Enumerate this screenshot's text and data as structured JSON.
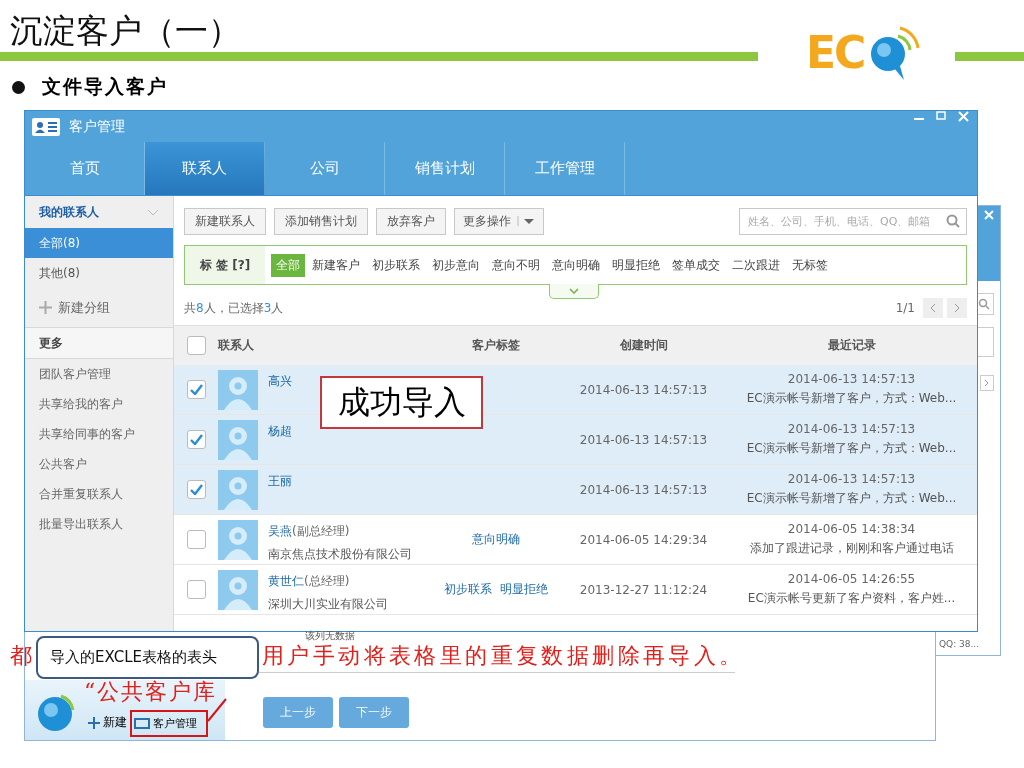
{
  "slide": {
    "title": "沉淀客户（一）",
    "bullet": "文件导入客户",
    "logo_text": "EC"
  },
  "window": {
    "title": "客户管理",
    "tabs": [
      {
        "label": "首页",
        "selected": false
      },
      {
        "label": "联系人",
        "selected": true
      },
      {
        "label": "公司",
        "selected": false
      },
      {
        "label": "销售计划",
        "selected": false
      },
      {
        "label": "工作管理",
        "selected": false
      }
    ]
  },
  "sidebar": {
    "group_title": "我的联系人",
    "items": [
      {
        "label": "全部(8)",
        "selected": true
      },
      {
        "label": "其他(8)",
        "selected": false
      }
    ],
    "new_group": "新建分组",
    "more_title": "更多",
    "more_items": [
      "团队客户管理",
      "共享给我的客户",
      "共享给同事的客户",
      "公共客户",
      "合并重复联系人",
      "批量导出联系人"
    ]
  },
  "toolbar": {
    "buttons": [
      "新建联系人",
      "添加销售计划",
      "放弃客户"
    ],
    "dropdown": "更多操作",
    "search_placeholder": "姓名、公司、手机、电话、QQ、邮箱"
  },
  "tag_filter": {
    "label": "标 签 [?]",
    "tags": [
      {
        "label": "全部",
        "selected": true
      },
      {
        "label": "新建客户",
        "selected": false
      },
      {
        "label": "初步联系",
        "selected": false
      },
      {
        "label": "初步意向",
        "selected": false
      },
      {
        "label": "意向不明",
        "selected": false
      },
      {
        "label": "意向明确",
        "selected": false
      },
      {
        "label": "明显拒绝",
        "selected": false
      },
      {
        "label": "签单成交",
        "selected": false
      },
      {
        "label": "二次跟进",
        "selected": false
      },
      {
        "label": "无标签",
        "selected": false
      }
    ]
  },
  "summary": {
    "prefix": "共",
    "total": "8",
    "middle": "人，已选择",
    "count": "3",
    "suffix": "人"
  },
  "pager": "1/1",
  "table": {
    "header_checked": false,
    "columns": [
      "联系人",
      "客户标签",
      "创建时间",
      "最近记录"
    ],
    "rows": [
      {
        "checked": true,
        "name": "高兴",
        "created": "2014-06-13 14:57:13",
        "recent_time": "2014-06-13 14:57:13",
        "recent_text": "EC演示帐号新增了客户，方式：Web..."
      },
      {
        "checked": true,
        "name": "杨超",
        "created": "2014-06-13 14:57:13",
        "recent_time": "2014-06-13 14:57:13",
        "recent_text": "EC演示帐号新增了客户，方式：Web..."
      },
      {
        "checked": true,
        "name": "王丽",
        "created": "2014-06-13 14:57:13",
        "recent_time": "2014-06-13 14:57:13",
        "recent_text": "EC演示帐号新增了客户，方式：Web..."
      },
      {
        "checked": false,
        "name": "吴燕",
        "title": "(副总经理)",
        "company": "南京焦点技术股份有限公司",
        "tags": [
          "意向明确"
        ],
        "created": "2014-06-05 14:29:34",
        "recent_time": "2014-06-05 14:38:34",
        "recent_text": "添加了跟进记录，刚刚和客户通过电话"
      },
      {
        "checked": false,
        "name": "黄世仁",
        "title": "(总经理)",
        "company": "深圳大川实业有限公司",
        "tags": [
          "初步联系",
          "明显拒绝"
        ],
        "created": "2013-12-27 11:12:24",
        "recent_time": "2014-06-05 14:26:55",
        "recent_text": "EC演示帐号更新了客户资料，客户姓..."
      }
    ]
  },
  "back_window": {
    "column_note": "该列无数据",
    "qq": "QQ: 38...",
    "buttons": [
      "上一步",
      "下一步"
    ],
    "launcher": {
      "new": "新建",
      "manage": "客户管理"
    }
  },
  "annotations": {
    "success": "成功导入",
    "instruction_parts": [
      "都",
      "用户手动将表格里的重复数据删除再导入。"
    ],
    "callout": "导入的EXCLE表格的表头",
    "public_pool": "“公共客户库"
  }
}
